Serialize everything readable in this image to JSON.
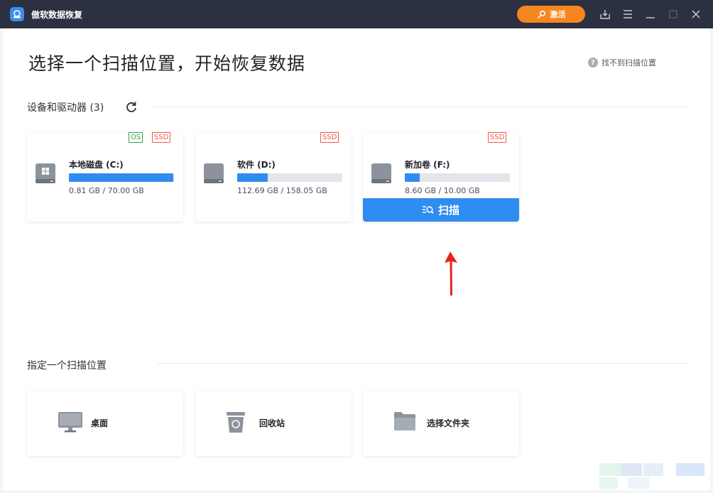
{
  "titlebar": {
    "app_title": "傲软数据恢复",
    "activate_label": "激活"
  },
  "main": {
    "title": "选择一个扫描位置，开始恢复数据",
    "help_link": "找不到扫描位置",
    "help_mark": "?"
  },
  "devices": {
    "section_title": "设备和驱动器 (3)",
    "drives": [
      {
        "name": "本地磁盘 (C:)",
        "size": "0.81 GB / 70.00 GB",
        "tags": [
          "OS",
          "SSD"
        ],
        "used_fraction": 0.99
      },
      {
        "name": "软件 (D:)",
        "size": "112.69 GB / 158.05 GB",
        "tags": [
          "SSD"
        ],
        "used_fraction": 0.29
      },
      {
        "name": "新加卷 (F:)",
        "size": "8.60 GB / 10.00 GB",
        "tags": [
          "SSD"
        ],
        "used_fraction": 0.14,
        "scan_label": "扫描"
      }
    ]
  },
  "locations": {
    "section_title": "指定一个扫描位置",
    "items": [
      {
        "label": "桌面",
        "icon": "desktop-icon"
      },
      {
        "label": "回收站",
        "icon": "recycle-bin-icon"
      },
      {
        "label": "选择文件夹",
        "icon": "folder-icon"
      }
    ]
  },
  "colors": {
    "accent": "#2f8cf0",
    "titlebar": "#2b3140",
    "activate": "#f6861f",
    "os_tag": "#2fa34a",
    "ssd_tag": "#ef5a4a",
    "annotation_arrow": "#e8231c"
  }
}
